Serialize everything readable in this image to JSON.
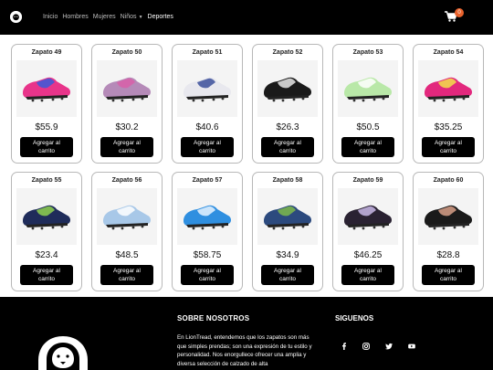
{
  "nav": {
    "links": [
      {
        "label": "Inicio"
      },
      {
        "label": "Hombres"
      },
      {
        "label": "Mujeres"
      },
      {
        "label": "Niños"
      },
      {
        "label": "Deportes"
      }
    ],
    "cart_count": "0"
  },
  "products": [
    {
      "name": "Zapato 49",
      "price": "$55.9",
      "button": "Agregar al carrito",
      "colors": [
        "#e8348a",
        "#3a5bd9"
      ]
    },
    {
      "name": "Zapato 50",
      "price": "$30.2",
      "button": "Agregar al carrito",
      "colors": [
        "#b58ab8",
        "#d85fa8"
      ]
    },
    {
      "name": "Zapato 51",
      "price": "$40.6",
      "button": "Agregar al carrito",
      "colors": [
        "#e8e8ee",
        "#3b4f9a"
      ]
    },
    {
      "name": "Zapato 52",
      "price": "$26.3",
      "button": "Agregar al carrito",
      "colors": [
        "#1a1a1a",
        "#e9e9e9"
      ]
    },
    {
      "name": "Zapato 53",
      "price": "$50.5",
      "button": "Agregar al carrito",
      "colors": [
        "#b9e8a8",
        "#ffffff"
      ]
    },
    {
      "name": "Zapato 54",
      "price": "$35.25",
      "button": "Agregar al carrito",
      "colors": [
        "#e2287d",
        "#f2e14a"
      ]
    },
    {
      "name": "Zapato 55",
      "price": "$23.4",
      "button": "Agregar al carrito",
      "colors": [
        "#1f2c5a",
        "#8fd14f"
      ]
    },
    {
      "name": "Zapato 56",
      "price": "$48.5",
      "button": "Agregar al carrito",
      "colors": [
        "#a8c8e8",
        "#ffffff"
      ]
    },
    {
      "name": "Zapato 57",
      "price": "$58.75",
      "button": "Agregar al carrito",
      "colors": [
        "#2f8fe0",
        "#e8f4ff"
      ]
    },
    {
      "name": "Zapato 58",
      "price": "$34.9",
      "button": "Agregar al carrito",
      "colors": [
        "#2c4a7e",
        "#7eb84a"
      ]
    },
    {
      "name": "Zapato 59",
      "price": "$46.25",
      "button": "Agregar al carrito",
      "colors": [
        "#2a2232",
        "#c9b8e8"
      ]
    },
    {
      "name": "Zapato 60",
      "price": "$28.8",
      "button": "Agregar al carrito",
      "colors": [
        "#1a1a1a",
        "#d8a088"
      ]
    }
  ],
  "footer": {
    "about_title": "SOBRE NOSOTROS",
    "about_text": "En LionTread, entendemos que los zapatos son más que simples prendas; son una expresión de tu estilo y personalidad. Nos enorgullece ofrecer una amplia y diversa selección de calzado de alta",
    "follow_title": "SIGUENOS",
    "social": [
      {
        "icon": "facebook-icon"
      },
      {
        "icon": "instagram-icon"
      },
      {
        "icon": "twitter-icon"
      },
      {
        "icon": "youtube-icon"
      }
    ]
  }
}
